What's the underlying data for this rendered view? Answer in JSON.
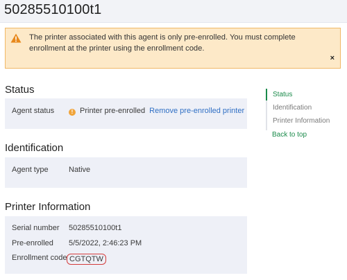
{
  "page": {
    "title": "50285510100t1"
  },
  "banner": {
    "message": "The printer associated with this agent is only pre-enrolled. You must complete enrollment at the printer using the enrollment code.",
    "close_label": "×"
  },
  "status": {
    "title": "Status",
    "agent_status_label": "Agent status",
    "agent_status_value": "Printer pre-enrolled",
    "status_icon_glyph": "!",
    "remove_link": "Remove pre-enrolled printer"
  },
  "identification": {
    "title": "Identification",
    "agent_type_label": "Agent type",
    "agent_type_value": "Native"
  },
  "printer_info": {
    "title": "Printer Information",
    "serial_label": "Serial number",
    "serial_value": "50285510100t1",
    "preenrolled_label": "Pre-enrolled",
    "preenrolled_value": "5/5/2022, 2:46:23 PM",
    "enrollment_label": "Enrollment code",
    "enrollment_value": "CGTQTW"
  },
  "toc": {
    "items": [
      "Status",
      "Identification",
      "Printer Information"
    ],
    "back_to_top": "Back to top"
  },
  "colors": {
    "accent_green": "#1a8a4a",
    "link_blue": "#2f6fc4",
    "warning_bg": "#fde9c8",
    "warning_border": "#f0b866",
    "card_bg": "#eef0f7"
  }
}
